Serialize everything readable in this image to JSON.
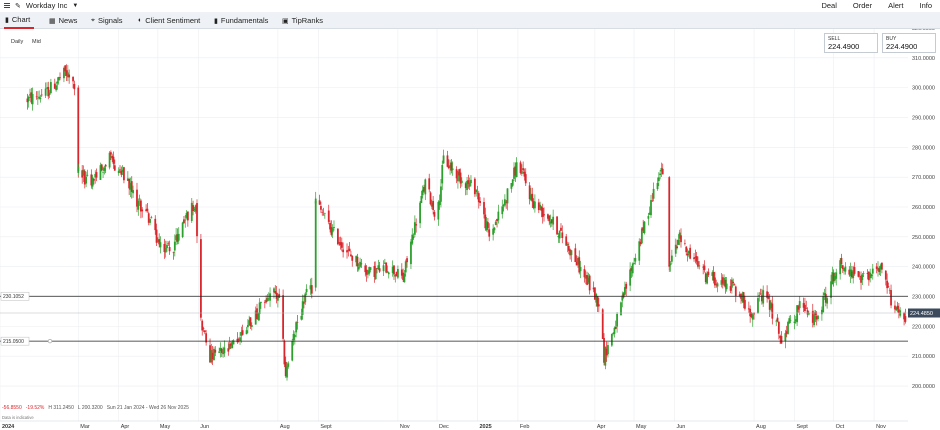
{
  "topbar": {
    "instrument": "Workday Inc",
    "deal": "Deal",
    "order": "Order",
    "alert": "Alert",
    "info": "Info"
  },
  "tabs": [
    {
      "label": "Chart",
      "icon": "candlestick-icon"
    },
    {
      "label": "News",
      "icon": "newspaper-icon"
    },
    {
      "label": "Signals",
      "icon": "signals-icon"
    },
    {
      "label": "Client Sentiment",
      "icon": "sentiment-icon"
    },
    {
      "label": "Fundamentals",
      "icon": "bar-chart-icon"
    },
    {
      "label": "TipRanks",
      "icon": "tipranks-icon"
    }
  ],
  "timeframe": {
    "interval": "Daily",
    "price_type": "Mid"
  },
  "quote": {
    "sell_label": "SELL",
    "sell": "224.4900",
    "buy_label": "BUY",
    "buy": "224.4900"
  },
  "stats": {
    "change": "-56.8550",
    "change_pct": "-19.52%",
    "high": "H 311.2450",
    "low": "L 200.3200",
    "range": "Sun 21 Jan 2024 - Wed 26 Nov 2025"
  },
  "note": "Data is indicative",
  "colors": {
    "up": "#2ca02c",
    "down": "#d9262c",
    "accent": "#d9262c",
    "price_tag": "#3b4a5c"
  },
  "chart_data": {
    "type": "candlestick",
    "ylim": [
      195,
      325
    ],
    "y_ticks": [
      "200.0000",
      "210.0000",
      "220.0000",
      "230.0000",
      "240.0000",
      "250.0000",
      "260.0000",
      "270.0000",
      "280.0000",
      "290.0000",
      "300.0000",
      "310.0000",
      "320.0000"
    ],
    "x_ticks": [
      {
        "label": "2024",
        "date": "2024-01-01",
        "bold": true
      },
      {
        "label": "Mar",
        "date": "2024-03-01"
      },
      {
        "label": "Apr",
        "date": "2024-04-01"
      },
      {
        "label": "May",
        "date": "2024-05-01"
      },
      {
        "label": "Jun",
        "date": "2024-06-01"
      },
      {
        "label": "Aug",
        "date": "2024-08-01"
      },
      {
        "label": "Sept",
        "date": "2024-09-01"
      },
      {
        "label": "Nov",
        "date": "2024-11-01"
      },
      {
        "label": "Dec",
        "date": "2024-12-01"
      },
      {
        "label": "2025",
        "date": "2025-01-01",
        "bold": true
      },
      {
        "label": "Feb",
        "date": "2025-02-01"
      },
      {
        "label": "Apr",
        "date": "2025-04-01"
      },
      {
        "label": "May",
        "date": "2025-05-01"
      },
      {
        "label": "Jun",
        "date": "2025-06-01"
      },
      {
        "label": "Aug",
        "date": "2025-08-01"
      },
      {
        "label": "Sept",
        "date": "2025-09-01"
      },
      {
        "label": "Oct",
        "date": "2025-10-01"
      },
      {
        "label": "Nov",
        "date": "2025-11-01"
      }
    ],
    "horizontal_lines": [
      {
        "label": "230.1052",
        "value": 230.1052
      },
      {
        "label": "215.0500",
        "value": 215.05
      }
    ],
    "current_price": {
      "label": "224.4850",
      "value": 224.485
    },
    "path": [
      [
        "2024-01-22",
        296
      ],
      [
        "2024-02-05",
        298
      ],
      [
        "2024-02-20",
        305
      ],
      [
        "2024-02-28",
        300
      ],
      [
        "2024-03-01",
        272
      ],
      [
        "2024-03-10",
        268
      ],
      [
        "2024-03-25",
        276
      ],
      [
        "2024-04-05",
        270
      ],
      [
        "2024-04-15",
        262
      ],
      [
        "2024-04-25",
        256
      ],
      [
        "2024-05-03",
        246
      ],
      [
        "2024-05-13",
        247
      ],
      [
        "2024-05-22",
        256
      ],
      [
        "2024-05-30",
        262
      ],
      [
        "2024-06-03",
        222
      ],
      [
        "2024-06-10",
        210
      ],
      [
        "2024-06-25",
        212
      ],
      [
        "2024-07-15",
        224
      ],
      [
        "2024-07-28",
        232
      ],
      [
        "2024-08-02",
        228
      ],
      [
        "2024-08-07",
        204
      ],
      [
        "2024-08-15",
        220
      ],
      [
        "2024-08-22",
        230
      ],
      [
        "2024-08-28",
        233
      ],
      [
        "2024-08-30",
        262
      ],
      [
        "2024-09-10",
        253
      ],
      [
        "2024-09-25",
        244
      ],
      [
        "2024-10-10",
        238
      ],
      [
        "2024-10-25",
        240
      ],
      [
        "2024-11-05",
        236
      ],
      [
        "2024-11-12",
        250
      ],
      [
        "2024-11-22",
        268
      ],
      [
        "2024-12-01",
        256
      ],
      [
        "2024-12-06",
        276
      ],
      [
        "2024-12-18",
        270
      ],
      [
        "2024-12-31",
        266
      ],
      [
        "2025-01-10",
        250
      ],
      [
        "2025-01-22",
        262
      ],
      [
        "2025-02-01",
        275
      ],
      [
        "2025-02-12",
        262
      ],
      [
        "2025-02-26",
        256
      ],
      [
        "2025-03-10",
        248
      ],
      [
        "2025-03-25",
        236
      ],
      [
        "2025-04-04",
        228
      ],
      [
        "2025-04-08",
        210
      ],
      [
        "2025-04-18",
        222
      ],
      [
        "2025-04-28",
        238
      ],
      [
        "2025-05-10",
        255
      ],
      [
        "2025-05-20",
        272
      ],
      [
        "2025-05-26",
        270
      ],
      [
        "2025-05-28",
        240
      ],
      [
        "2025-06-05",
        250
      ],
      [
        "2025-06-12",
        244
      ],
      [
        "2025-06-25",
        237
      ],
      [
        "2025-07-15",
        234
      ],
      [
        "2025-07-30",
        225
      ],
      [
        "2025-08-10",
        231
      ],
      [
        "2025-08-22",
        216
      ],
      [
        "2025-09-05",
        227
      ],
      [
        "2025-09-15",
        222
      ],
      [
        "2025-09-25",
        230
      ],
      [
        "2025-10-05",
        242
      ],
      [
        "2025-10-20",
        235
      ],
      [
        "2025-11-05",
        240
      ],
      [
        "2025-11-15",
        228
      ],
      [
        "2025-11-26",
        222
      ]
    ]
  }
}
